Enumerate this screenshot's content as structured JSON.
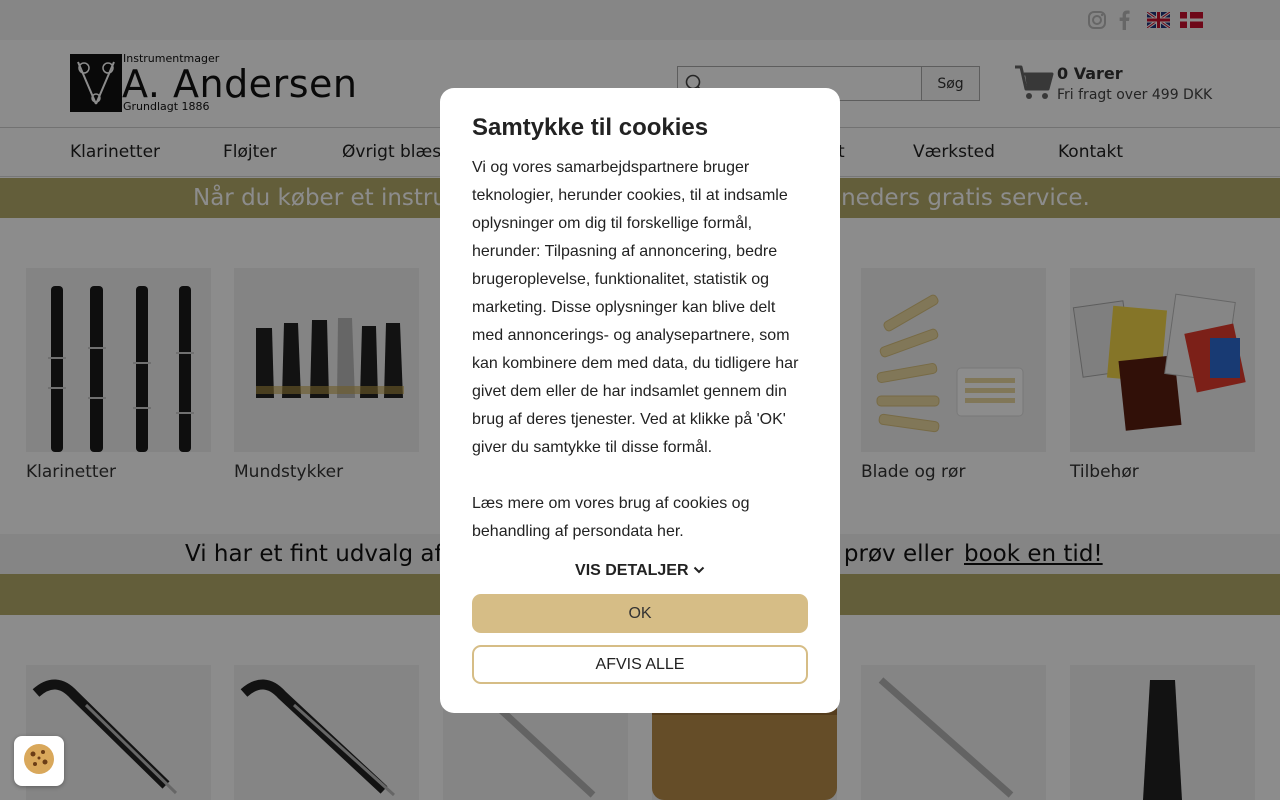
{
  "topbar": {
    "social_icons": [
      "instagram-icon",
      "facebook-icon"
    ],
    "flags": [
      "flag-uk",
      "flag-denmark"
    ]
  },
  "logo": {
    "superscript": "Instrumentmager",
    "name": "A. Andersen",
    "subtitle": "Grundlagt 1886"
  },
  "search": {
    "placeholder": "",
    "button_label": "Søg"
  },
  "cart": {
    "count_label": "0 Varer",
    "freight_label": "Fri fragt over 499 DKK"
  },
  "nav": {
    "items": [
      "Klarinetter",
      "Fløjter",
      "Øvrigt blæs",
      "t",
      "Værksted",
      "Kontakt"
    ]
  },
  "banner_top": {
    "left_text": "Når du køber et instrur",
    "right_text": "åneders gratis service."
  },
  "categories": {
    "items": [
      {
        "label": "Klarinetter"
      },
      {
        "label": "Mundstykker"
      },
      {
        "label": "Blade og rør"
      },
      {
        "label": "Tilbehør"
      }
    ]
  },
  "banner_mid": {
    "left_text": "Vi har et fint udvalg af t",
    "middle_text": "g prøv eller ",
    "link_text": "book en tid!"
  },
  "cookie_modal": {
    "title": "Samtykke til cookies",
    "body": "Vi og vores samarbejdspartnere bruger teknologier, herunder cookies, til at indsamle oplysninger om dig til forskellige formål, herunder: Tilpasning af annoncering, bedre brugeroplevelse, funktionalitet, statistik og marketing. Disse oplysninger kan blive delt med annoncerings- og analysepartnere, som kan kombinere dem med data, du tidligere har givet dem eller de har indsamlet gennem din brug af deres tjenester. Ved at klikke på 'OK' giver du samtykke til disse formål.",
    "more": "Læs mere om vores brug af cookies og behandling af persondata her.",
    "details_label": "VIS DETALJER",
    "ok_label": "OK",
    "deny_label": "AFVIS ALLE"
  },
  "colors": {
    "accent": "#d6bd86",
    "banner": "#b5ab6a"
  }
}
